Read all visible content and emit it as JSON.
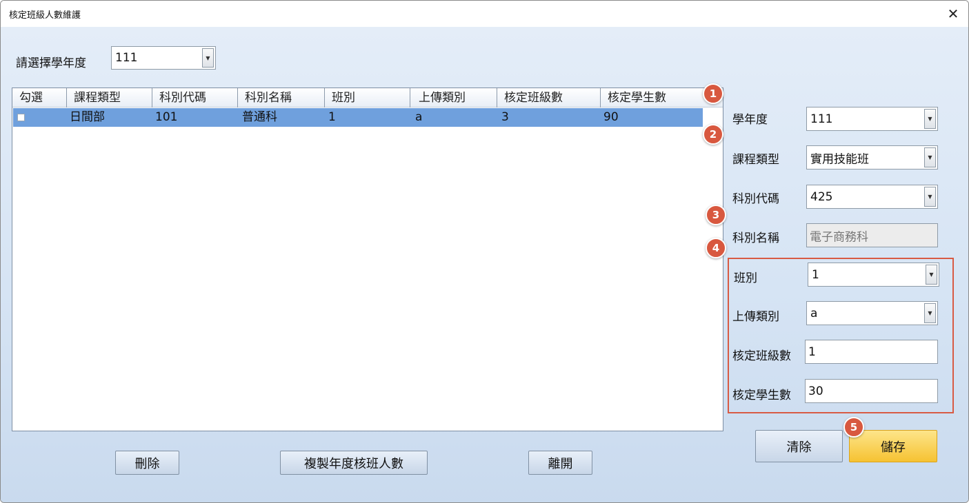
{
  "window": {
    "title": "核定班級人數維護"
  },
  "year_selector": {
    "label": "請選擇學年度",
    "value": "111"
  },
  "grid": {
    "columns": [
      "勾選",
      "課程類型",
      "科別代碼",
      "科別名稱",
      "班別",
      "上傳類別",
      "核定班級數",
      "核定學生數"
    ],
    "rows": [
      {
        "course_type": "日間部",
        "dept_code": "101",
        "dept_name": "普通科",
        "class": "1",
        "upload_type": "a",
        "class_count": "3",
        "student_count": "90"
      }
    ]
  },
  "form": {
    "year": {
      "label": "學年度",
      "value": "111"
    },
    "course_type": {
      "label": "課程類型",
      "value": "實用技能班"
    },
    "dept_code": {
      "label": "科別代碼",
      "value": "425"
    },
    "dept_name": {
      "label": "科別名稱",
      "value": "電子商務科"
    },
    "class": {
      "label": "班別",
      "value": "1"
    },
    "upload_type": {
      "label": "上傳類別",
      "value": "a"
    },
    "class_count": {
      "label": "核定班級數",
      "value": "1"
    },
    "student_count": {
      "label": "核定學生數",
      "value": "30"
    }
  },
  "buttons": {
    "delete": "刪除",
    "copy": "複製年度核班人數",
    "exit": "離開",
    "clear": "清除",
    "save": "儲存"
  },
  "markers": [
    "1",
    "2",
    "3",
    "4",
    "5"
  ],
  "colors": {
    "selected_row": "#6fa0dd",
    "marker": "#d8583f",
    "save_button": "#f6c232",
    "highlight_box": "#d85a43"
  }
}
